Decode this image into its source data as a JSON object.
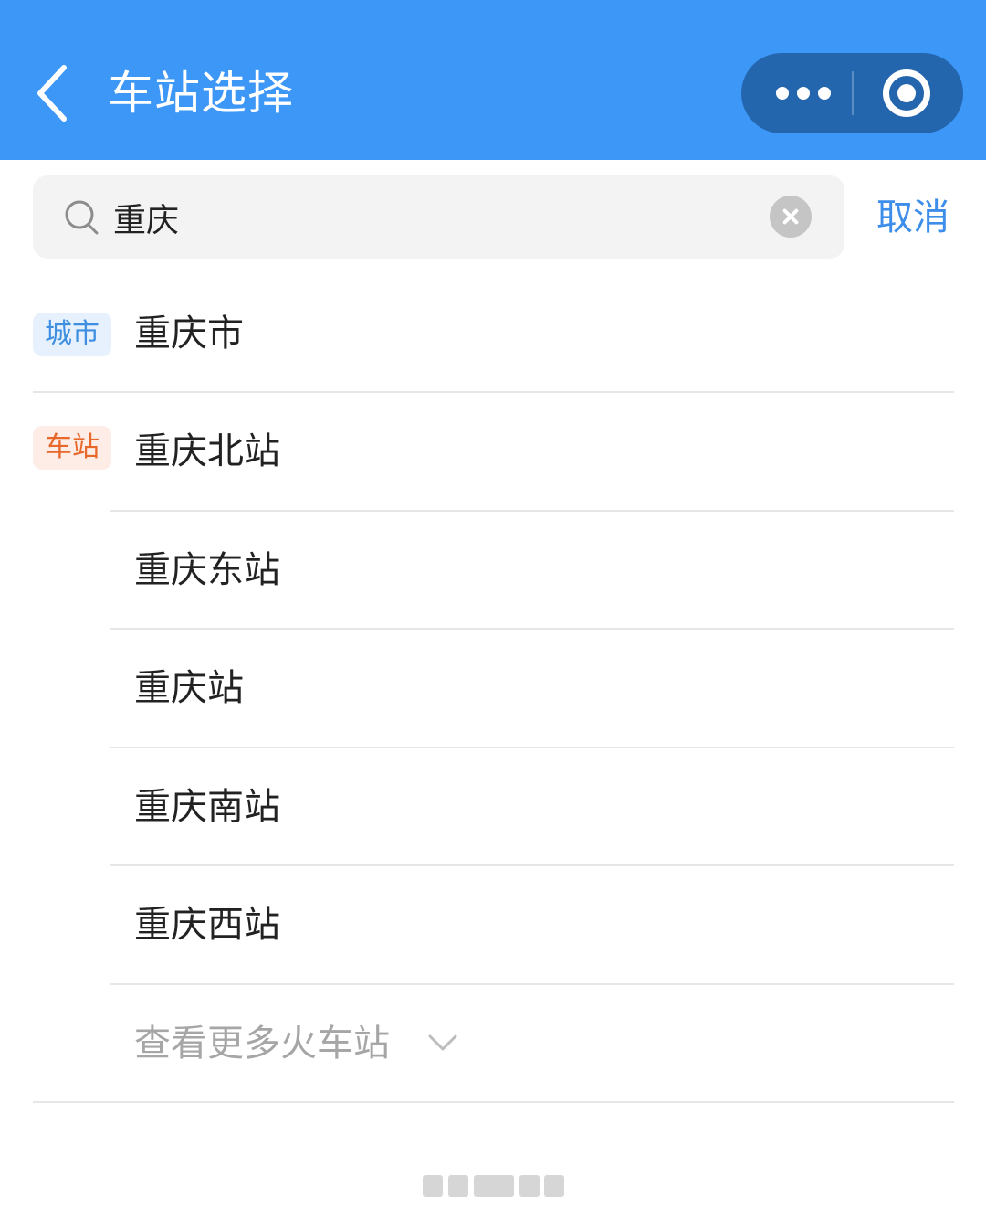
{
  "header": {
    "title": "车站选择",
    "background_color": "#3d97f7",
    "back_icon": "chevron-left-icon",
    "more_icon": "more-dots-icon",
    "close_icon": "target-circle-icon"
  },
  "search": {
    "value": "重庆",
    "placeholder": "",
    "cancel_label": "取消",
    "icon": "search-icon",
    "clear_icon": "clear-icon"
  },
  "results": {
    "city_tag": "城市",
    "station_tag": "车站",
    "city_tag_color": "#3f8fe0",
    "station_tag_color": "#e8672a",
    "city": {
      "name": "重庆市"
    },
    "stations": [
      {
        "name": "重庆北站"
      },
      {
        "name": "重庆东站"
      },
      {
        "name": "重庆站"
      },
      {
        "name": "重庆南站"
      },
      {
        "name": "重庆西站"
      }
    ],
    "more_label": "查看更多火车站",
    "more_icon": "chevron-down-icon"
  }
}
